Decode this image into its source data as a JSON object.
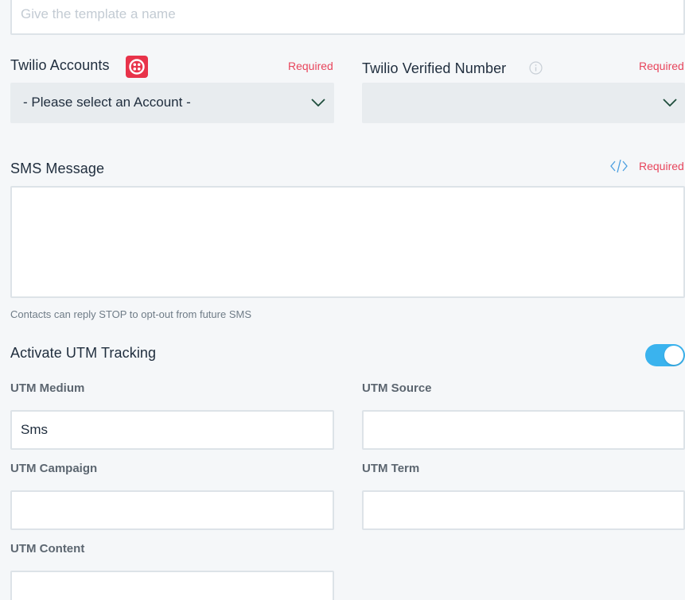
{
  "template_name": {
    "value": "",
    "placeholder": "Give the template a name"
  },
  "twilio_accounts": {
    "label": "Twilio Accounts",
    "required": "Required",
    "selected": "- Please select an Account -"
  },
  "verified_number": {
    "label": "Twilio Verified Number",
    "required": "Required",
    "selected": ""
  },
  "sms_message": {
    "label": "SMS Message",
    "required": "Required",
    "value": "",
    "helper": "Contacts can reply STOP to opt-out from future SMS"
  },
  "utm_tracking": {
    "label": "Activate UTM Tracking",
    "enabled": true,
    "accent_color": "#3ab3ee"
  },
  "utm_fields": {
    "medium": {
      "label": "UTM Medium",
      "value": "Sms"
    },
    "source": {
      "label": "UTM Source",
      "value": ""
    },
    "campaign": {
      "label": "UTM Campaign",
      "value": ""
    },
    "term": {
      "label": "UTM Term",
      "value": ""
    },
    "content": {
      "label": "UTM Content",
      "value": ""
    }
  },
  "colors": {
    "required": "#e8455c",
    "twilio_brand": "#e8334a",
    "code_icon": "#4a9ee0"
  },
  "icons": {
    "twilio": "twilio-logo-icon",
    "info": "info-icon",
    "code": "code-icon",
    "chevron": "chevron-down-icon"
  }
}
